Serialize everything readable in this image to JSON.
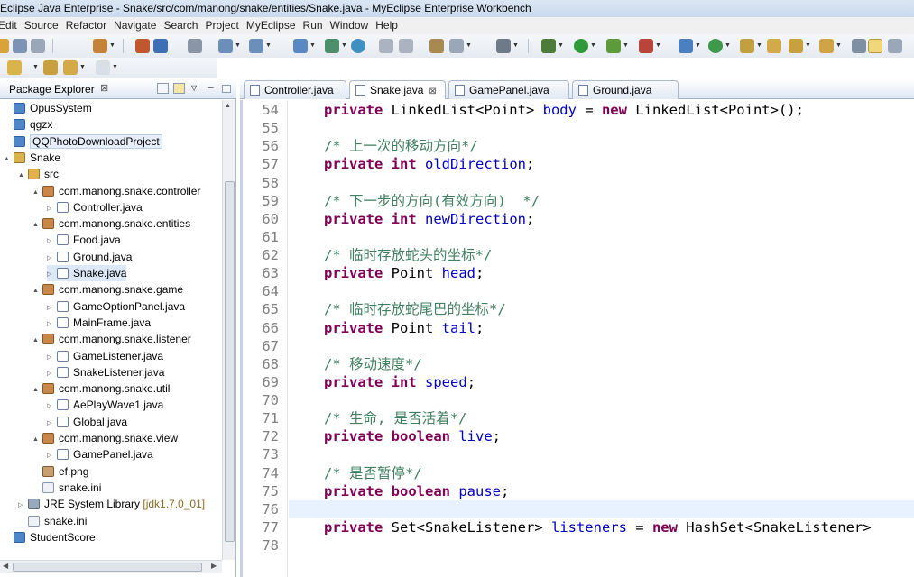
{
  "window_title": "Eclipse Java Enterprise - Snake/src/com/manong/snake/entities/Snake.java - MyEclipse Enterprise Workbench",
  "menu": [
    "Edit",
    "Source",
    "Refactor",
    "Navigate",
    "Search",
    "Project",
    "MyEclipse",
    "Run",
    "Window",
    "Help"
  ],
  "package_explorer": {
    "title": "Package Explorer",
    "close": "⊠",
    "tree": [
      {
        "label": "OpusSystem",
        "icon": "folder-icon",
        "depth": 0,
        "expand": ""
      },
      {
        "label": "qgzx",
        "icon": "folder-icon",
        "depth": 0,
        "expand": ""
      },
      {
        "label": "QQPhotoDownloadProject",
        "icon": "folder-icon",
        "depth": 0,
        "expand": "",
        "highlight": true
      },
      {
        "label": "Snake",
        "icon": "project-icon",
        "depth": 0,
        "expand": "▲"
      },
      {
        "label": "src",
        "icon": "source-folder-icon",
        "depth": 1,
        "expand": "▲"
      },
      {
        "label": "com.manong.snake.controller",
        "icon": "package-icon",
        "depth": 2,
        "expand": "▲"
      },
      {
        "label": "Controller.java",
        "icon": "java-file-icon",
        "depth": 3,
        "expand": "▷"
      },
      {
        "label": "com.manong.snake.entities",
        "icon": "package-icon",
        "depth": 2,
        "expand": "▲"
      },
      {
        "label": "Food.java",
        "icon": "java-file-icon",
        "depth": 3,
        "expand": "▷"
      },
      {
        "label": "Ground.java",
        "icon": "java-file-icon",
        "depth": 3,
        "expand": "▷"
      },
      {
        "label": "Snake.java",
        "icon": "java-file-icon",
        "depth": 3,
        "expand": "▷",
        "selected": true
      },
      {
        "label": "com.manong.snake.game",
        "icon": "package-icon",
        "depth": 2,
        "expand": "▲"
      },
      {
        "label": "GameOptionPanel.java",
        "icon": "java-file-icon",
        "depth": 3,
        "expand": "▷"
      },
      {
        "label": "MainFrame.java",
        "icon": "java-file-icon",
        "depth": 3,
        "expand": "▷"
      },
      {
        "label": "com.manong.snake.listener",
        "icon": "package-icon",
        "depth": 2,
        "expand": "▲"
      },
      {
        "label": "GameListener.java",
        "icon": "java-file-icon",
        "depth": 3,
        "expand": "▷"
      },
      {
        "label": "SnakeListener.java",
        "icon": "java-file-icon",
        "depth": 3,
        "expand": "▷"
      },
      {
        "label": "com.manong.snake.util",
        "icon": "package-icon",
        "depth": 2,
        "expand": "▲"
      },
      {
        "label": "AePlayWave1.java",
        "icon": "java-file-icon",
        "depth": 3,
        "expand": "▷"
      },
      {
        "label": "Global.java",
        "icon": "java-file-icon",
        "depth": 3,
        "expand": "▷"
      },
      {
        "label": "com.manong.snake.view",
        "icon": "package-icon",
        "depth": 2,
        "expand": "▲"
      },
      {
        "label": "GamePanel.java",
        "icon": "java-file-icon",
        "depth": 3,
        "expand": "▷"
      },
      {
        "label": "ef.png",
        "icon": "image-file-icon",
        "depth": 2,
        "expand": ""
      },
      {
        "label": "snake.ini",
        "icon": "ini-file-icon",
        "depth": 2,
        "expand": ""
      },
      {
        "label": "JRE System Library",
        "suffix": "[jdk1.7.0_01]",
        "icon": "library-icon",
        "depth": 1,
        "expand": "▷"
      },
      {
        "label": "snake.ini",
        "icon": "ini-file-icon",
        "depth": 1,
        "expand": ""
      },
      {
        "label": "StudentScore",
        "icon": "folder-icon",
        "depth": 0,
        "expand": ""
      }
    ]
  },
  "editor": {
    "tabs": [
      {
        "label": "Controller.java",
        "active": false
      },
      {
        "label": "Snake.java",
        "active": true,
        "close": "⊠"
      },
      {
        "label": "GamePanel.java",
        "active": false
      },
      {
        "label": "Ground.java",
        "active": false
      }
    ],
    "current_line": 76,
    "lines": [
      {
        "n": "54",
        "tokens": [
          {
            "t": "private",
            "c": "kw"
          },
          {
            "t": " LinkedList<Point> "
          },
          {
            "t": "body",
            "c": "fld"
          },
          {
            "t": " = "
          },
          {
            "t": "new",
            "c": "kw"
          },
          {
            "t": " LinkedList<Point>();"
          }
        ]
      },
      {
        "n": "55",
        "tokens": []
      },
      {
        "n": "56",
        "tokens": [
          {
            "t": "/* 上一次的移动方向*/",
            "c": "cm"
          }
        ]
      },
      {
        "n": "57",
        "tokens": [
          {
            "t": "private",
            "c": "kw"
          },
          {
            "t": " "
          },
          {
            "t": "int",
            "c": "kw"
          },
          {
            "t": " "
          },
          {
            "t": "oldDirection",
            "c": "fld"
          },
          {
            "t": ";"
          }
        ]
      },
      {
        "n": "58",
        "tokens": []
      },
      {
        "n": "59",
        "tokens": [
          {
            "t": "/* 下一步的方向(有效方向)  */",
            "c": "cm"
          }
        ]
      },
      {
        "n": "60",
        "tokens": [
          {
            "t": "private",
            "c": "kw"
          },
          {
            "t": " "
          },
          {
            "t": "int",
            "c": "kw"
          },
          {
            "t": " "
          },
          {
            "t": "newDirection",
            "c": "fld"
          },
          {
            "t": ";"
          }
        ]
      },
      {
        "n": "61",
        "tokens": []
      },
      {
        "n": "62",
        "tokens": [
          {
            "t": "/* 临时存放蛇头的坐标*/",
            "c": "cm"
          }
        ]
      },
      {
        "n": "63",
        "tokens": [
          {
            "t": "private",
            "c": "kw"
          },
          {
            "t": " Point "
          },
          {
            "t": "head",
            "c": "fld"
          },
          {
            "t": ";"
          }
        ]
      },
      {
        "n": "64",
        "tokens": []
      },
      {
        "n": "65",
        "tokens": [
          {
            "t": "/* 临时存放蛇尾巴的坐标*/",
            "c": "cm"
          }
        ]
      },
      {
        "n": "66",
        "tokens": [
          {
            "t": "private",
            "c": "kw"
          },
          {
            "t": " Point "
          },
          {
            "t": "tail",
            "c": "fld"
          },
          {
            "t": ";"
          }
        ]
      },
      {
        "n": "67",
        "tokens": []
      },
      {
        "n": "68",
        "tokens": [
          {
            "t": "/* 移动速度*/",
            "c": "cm"
          }
        ]
      },
      {
        "n": "69",
        "tokens": [
          {
            "t": "private",
            "c": "kw"
          },
          {
            "t": " "
          },
          {
            "t": "int",
            "c": "kw"
          },
          {
            "t": " "
          },
          {
            "t": "speed",
            "c": "fld"
          },
          {
            "t": ";"
          }
        ]
      },
      {
        "n": "70",
        "tokens": []
      },
      {
        "n": "71",
        "tokens": [
          {
            "t": "/* 生命, 是否活着*/",
            "c": "cm"
          }
        ]
      },
      {
        "n": "72",
        "tokens": [
          {
            "t": "private",
            "c": "kw"
          },
          {
            "t": " "
          },
          {
            "t": "boolean",
            "c": "kw"
          },
          {
            "t": " "
          },
          {
            "t": "live",
            "c": "fld"
          },
          {
            "t": ";"
          }
        ]
      },
      {
        "n": "73",
        "tokens": []
      },
      {
        "n": "74",
        "tokens": [
          {
            "t": "/* 是否暂停*/",
            "c": "cm"
          }
        ]
      },
      {
        "n": "75",
        "tokens": [
          {
            "t": "private",
            "c": "kw"
          },
          {
            "t": " "
          },
          {
            "t": "boolean",
            "c": "kw"
          },
          {
            "t": " "
          },
          {
            "t": "pause",
            "c": "fld"
          },
          {
            "t": ";"
          }
        ]
      },
      {
        "n": "76",
        "tokens": []
      },
      {
        "n": "77",
        "tokens": [
          {
            "t": "private",
            "c": "kw"
          },
          {
            "t": " Set<SnakeListener> "
          },
          {
            "t": "listeners",
            "c": "fld"
          },
          {
            "t": " = "
          },
          {
            "t": "new",
            "c": "kw"
          },
          {
            "t": " HashSet<SnakeListener>"
          }
        ]
      },
      {
        "n": "78",
        "tokens": []
      }
    ]
  },
  "colors": {
    "keyword": "#7f0055",
    "field": "#0000c0",
    "comment": "#3f7f5f",
    "current_line": "#e8f2fe"
  }
}
